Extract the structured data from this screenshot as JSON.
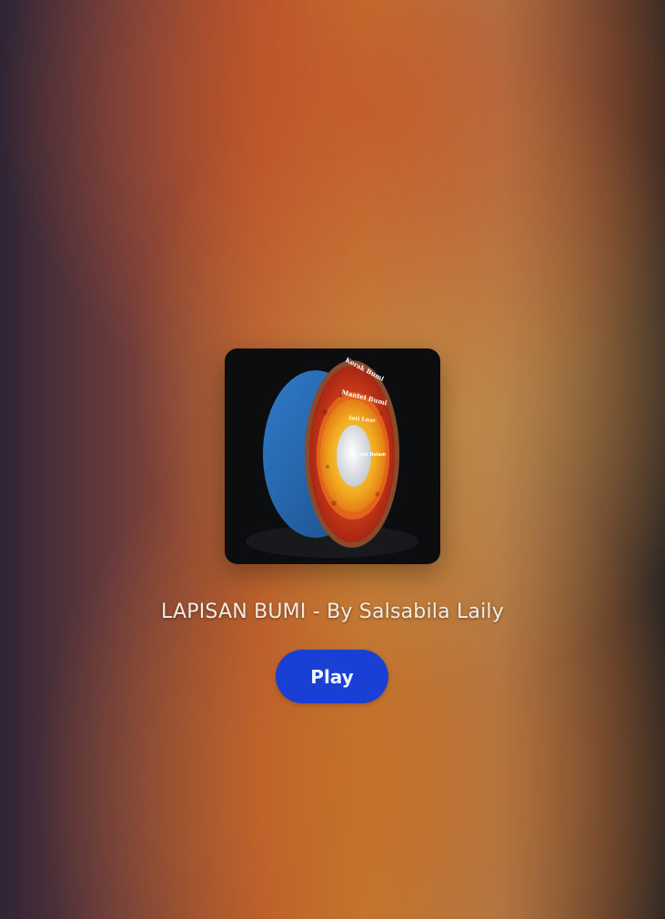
{
  "game": {
    "title": "LAPISAN BUMI - By Salsabila Laily",
    "cover_image": {
      "subject": "earth-layers-cross-section",
      "labels": [
        "Kerak Bumi",
        "Mantel Bumi",
        "Inti Luar",
        "Inti Dalam"
      ]
    }
  },
  "actions": {
    "play_label": "Play"
  },
  "colors": {
    "play_button": "#1a3fd4",
    "title_text": "#f3ece4",
    "cover_background": "#0c0d0f"
  }
}
